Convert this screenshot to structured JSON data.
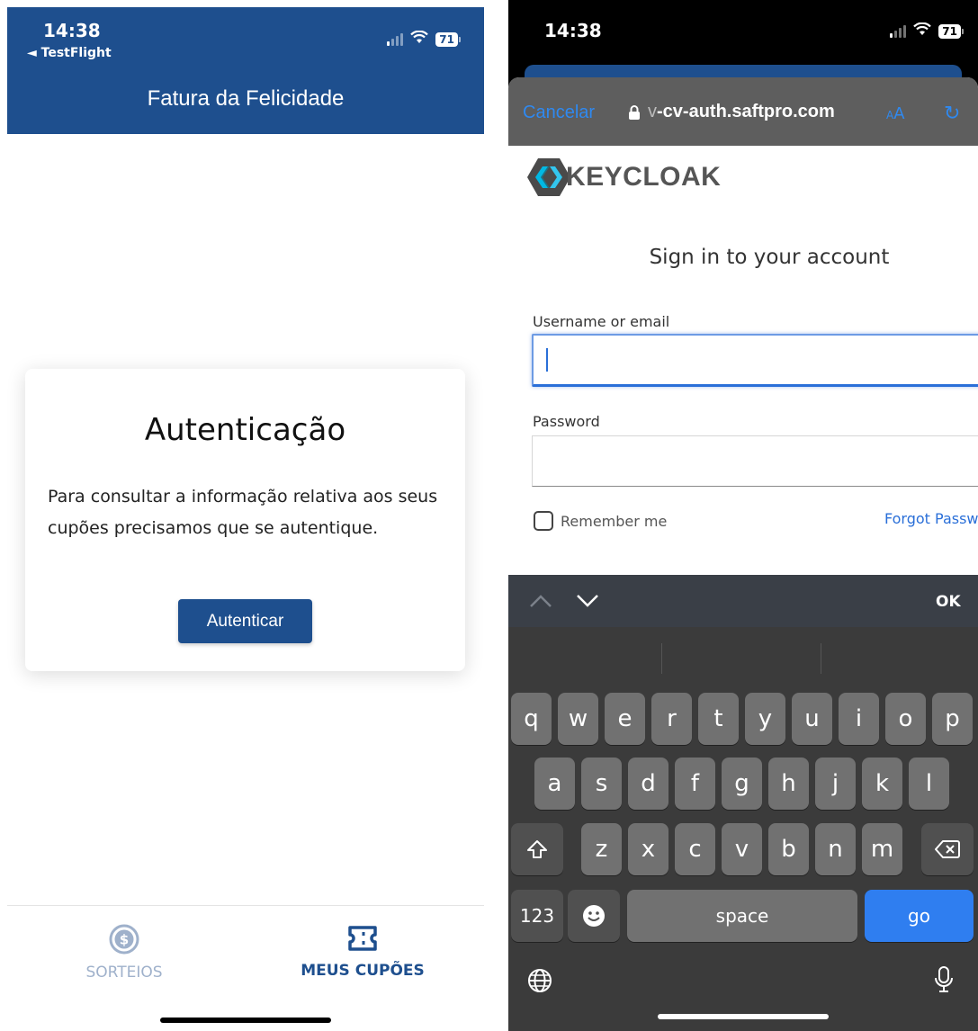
{
  "left": {
    "status": {
      "time": "14:38",
      "back_label": "◄ TestFlight",
      "battery": "71"
    },
    "header_title": "Fatura da Felicidade",
    "card": {
      "title": "Autenticação",
      "text": "Para consultar a informação relativa aos seus cupões precisamos que se autentique.",
      "button": "Autenticar"
    },
    "tabs": [
      {
        "label": "SORTEIOS",
        "icon": "dollar-circle-icon",
        "active": false
      },
      {
        "label": "MEUS CUPÕES",
        "icon": "ticket-icon",
        "active": true
      }
    ],
    "colors": {
      "primary": "#1e4f8e",
      "inactive_tab": "#9fb1cb"
    }
  },
  "right": {
    "status": {
      "time": "14:38",
      "battery": "71"
    },
    "browser": {
      "cancel": "Cancelar",
      "url_prefix": "v",
      "url_main": "-cv-auth.saftpro.com",
      "aa_small": "A",
      "aa_large": "A"
    },
    "login": {
      "brand": "KEYCLOAK",
      "title": "Sign in to your account",
      "username_label": "Username or email",
      "password_label": "Password",
      "remember_label": "Remember me",
      "forgot_label": "Forgot Passw"
    },
    "keyboard": {
      "ok": "OK",
      "row1": [
        "q",
        "w",
        "e",
        "r",
        "t",
        "y",
        "u",
        "i",
        "o",
        "p"
      ],
      "row2": [
        "a",
        "s",
        "d",
        "f",
        "g",
        "h",
        "j",
        "k",
        "l"
      ],
      "row3": [
        "z",
        "x",
        "c",
        "v",
        "b",
        "n",
        "m"
      ],
      "num_key": "123",
      "space": "space",
      "go": "go"
    }
  }
}
